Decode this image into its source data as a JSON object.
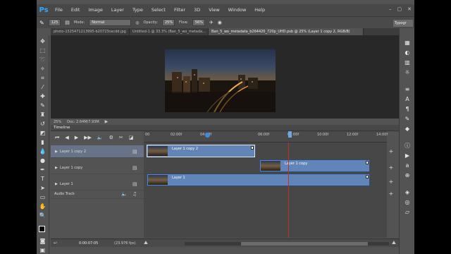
{
  "app": {
    "logo": "Ps"
  },
  "menu": [
    "File",
    "Edit",
    "Image",
    "Layer",
    "Type",
    "Select",
    "Filter",
    "3D",
    "View",
    "Window",
    "Help"
  ],
  "options": {
    "mode_label": "Mode:",
    "mode_value": "Normal",
    "opacity_label": "Opacity:",
    "opacity_value": "25%",
    "flow_label": "Flow:",
    "flow_value": "56%",
    "brush_size": "125",
    "workspace": "Typogr"
  },
  "tabs": [
    {
      "label": "photo-1525471213995-b20723cecdd.jpg",
      "active": false
    },
    {
      "label": "Untitled-1 @ 33.3% (Ban_5_wo_metada...",
      "active": false
    },
    {
      "label": "Ban_5_wo_metadata_b264420_720p_UHD.psb @ 25% (Layer 1 copy 2, RGB/8)",
      "active": true
    }
  ],
  "status": {
    "zoom": "25%",
    "doc": "Doc: 2.64M/7.93M"
  },
  "timeline": {
    "title": "Timeline",
    "ruler": [
      "00",
      "02:00f",
      "04:00f",
      "06:00f",
      "08:00f",
      "10:00f",
      "12:00f",
      "14:00f"
    ],
    "layers": [
      {
        "name": "Layer 1 copy 2",
        "selected": true
      },
      {
        "name": "Layer 1 copy",
        "selected": false
      },
      {
        "name": "Layer 1",
        "selected": false
      },
      {
        "name": "Audio Track",
        "selected": false
      }
    ],
    "clips": [
      {
        "label": "Layer 1 copy 2"
      },
      {
        "label": "Layer 1 copy"
      },
      {
        "label": "Layer 1"
      }
    ],
    "timecode": "0:00:07:05",
    "fps": "(23.976 fps)"
  },
  "colors": {
    "accent": "#31a8ff",
    "clip": "#6185b8",
    "playhead": "#c0302a"
  }
}
